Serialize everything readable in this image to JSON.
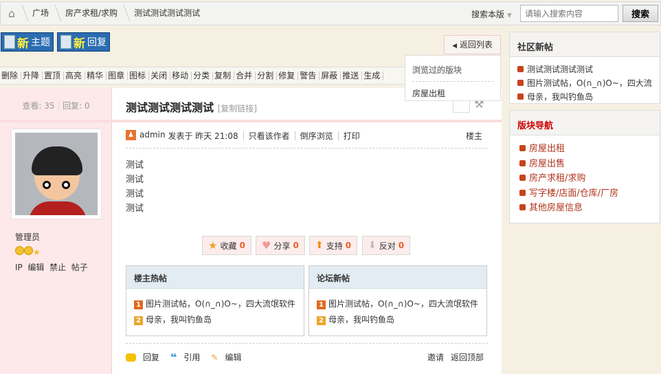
{
  "breadcrumb": {
    "items": [
      "广场",
      "房产求租/求购",
      "测试测试测试测试"
    ]
  },
  "search": {
    "scope": "搜索本版",
    "placeholder": "请输入搜索内容",
    "button": "搜索"
  },
  "actions": {
    "new_topic_big": "新",
    "new_topic": "主题",
    "new_reply_big": "新",
    "new_reply": "回复",
    "back_to_list": "返回列表"
  },
  "mod_toolbar": [
    "删除",
    "升降",
    "置顶",
    "高亮",
    "精华",
    "图章",
    "图标",
    "关闭",
    "移动",
    "分类",
    "复制",
    "合并",
    "分割",
    "修复",
    "警告",
    "屏蔽",
    "推送",
    "生成"
  ],
  "visited_dropdown": {
    "title": "浏览过的版块",
    "items": [
      "房屋出租"
    ]
  },
  "thread": {
    "views_label": "查看:",
    "views": "35",
    "replies_label": "回复:",
    "replies": "0",
    "title": "测试测试测试测试",
    "copy_link": "[复制链接]"
  },
  "author": {
    "role": "管理员",
    "links": [
      "IP",
      "编辑",
      "禁止",
      "帖子"
    ]
  },
  "post": {
    "author": "admin",
    "posted": "发表于 昨天 21:08",
    "only_author": "只看该作者",
    "reverse": "倒序浏览",
    "print": "打印",
    "floor": "楼主",
    "content": [
      "测试",
      "测试",
      "测试",
      "测试"
    ]
  },
  "votes": [
    {
      "label": "收藏",
      "count": "0"
    },
    {
      "label": "分享",
      "count": "0"
    },
    {
      "label": "支持",
      "count": "0"
    },
    {
      "label": "反对",
      "count": "0"
    }
  ],
  "related": [
    {
      "title": "楼主热帖",
      "items": [
        "图片测试帖，O(∩_∩)O~，四大流氓软件",
        "母亲，我叫钓鱼岛"
      ]
    },
    {
      "title": "论坛新帖",
      "items": [
        "图片测试帖，O(∩_∩)O~，四大流氓软件",
        "母亲，我叫钓鱼岛"
      ]
    }
  ],
  "post_footer": {
    "reply": "回复",
    "quote": "引用",
    "edit": "编辑",
    "invite": "邀请",
    "top": "返回顶部"
  },
  "sidebar": {
    "new_posts": {
      "title": "社区新帖",
      "items": [
        "测试测试测试测试",
        "图片测试帖，O(∩_∩)O~，四大流",
        "母亲，我叫钓鱼岛"
      ]
    },
    "nav": {
      "title": "版块导航",
      "items": [
        "房屋出租",
        "房屋出售",
        "房产求租/求购",
        "写字楼/店面/仓库/厂房",
        "其他房屋信息"
      ]
    }
  }
}
